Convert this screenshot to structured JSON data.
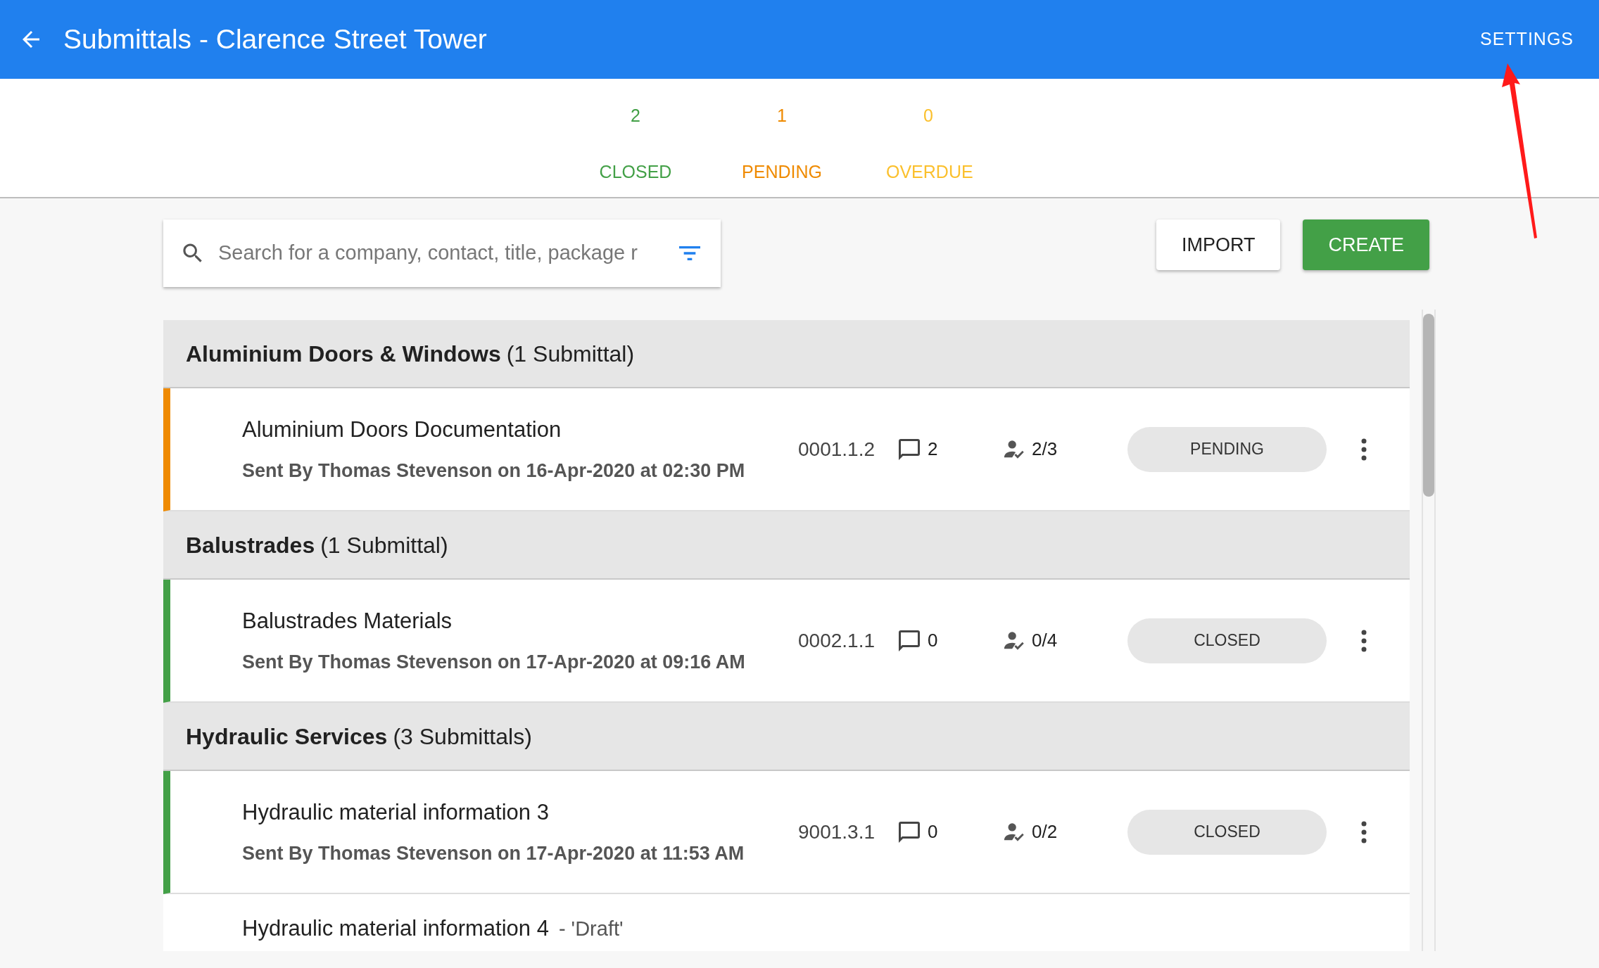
{
  "app_bar": {
    "title": "Submittals - Clarence Street Tower",
    "action": "SETTINGS"
  },
  "summary": [
    {
      "count": "2",
      "label": "CLOSED",
      "color": "#43a047"
    },
    {
      "count": "1",
      "label": "PENDING",
      "color": "#ef8a00"
    },
    {
      "count": "0",
      "label": "OVERDUE",
      "color": "#fbc02d"
    }
  ],
  "search": {
    "placeholder": "Search for a company, contact, title, package r"
  },
  "buttons": [
    {
      "label": "IMPORT",
      "kind": "secondary"
    },
    {
      "label": "CREATE",
      "kind": "primary"
    }
  ],
  "groups": [
    {
      "name": "Aluminium Doors & Windows",
      "count": "(1 Submittal)",
      "submittals": [
        {
          "kind": "full",
          "title": "Aluminium Doors Documentation",
          "subtitle": "Sent By Thomas Stevenson on 16-Apr-2020 at 02:30 PM",
          "number": "0001.1.2",
          "comments": "2",
          "approvals": "2/3",
          "status": "PENDING",
          "color": "#ef8a00"
        }
      ]
    },
    {
      "name": "Balustrades",
      "count": "(1 Submittal)",
      "submittals": [
        {
          "kind": "full",
          "title": "Balustrades Materials",
          "subtitle": "Sent By Thomas Stevenson on 17-Apr-2020 at 09:16 AM",
          "number": "0002.1.1",
          "comments": "0",
          "approvals": "0/4",
          "status": "CLOSED",
          "color": "#43a047"
        }
      ]
    },
    {
      "name": "Hydraulic Services",
      "count": "(3 Submittals)",
      "submittals": [
        {
          "kind": "full",
          "title": "Hydraulic material information 3",
          "subtitle": "Sent By Thomas Stevenson on 17-Apr-2020 at 11:53 AM",
          "number": "9001.3.1",
          "comments": "0",
          "approvals": "0/2",
          "status": "CLOSED",
          "color": "#43a047"
        },
        {
          "kind": "cut",
          "title": "Hydraulic material information 4",
          "draft_tag": "- 'Draft'"
        }
      ]
    }
  ],
  "annotations": [
    {
      "kind": "arrow"
    }
  ]
}
